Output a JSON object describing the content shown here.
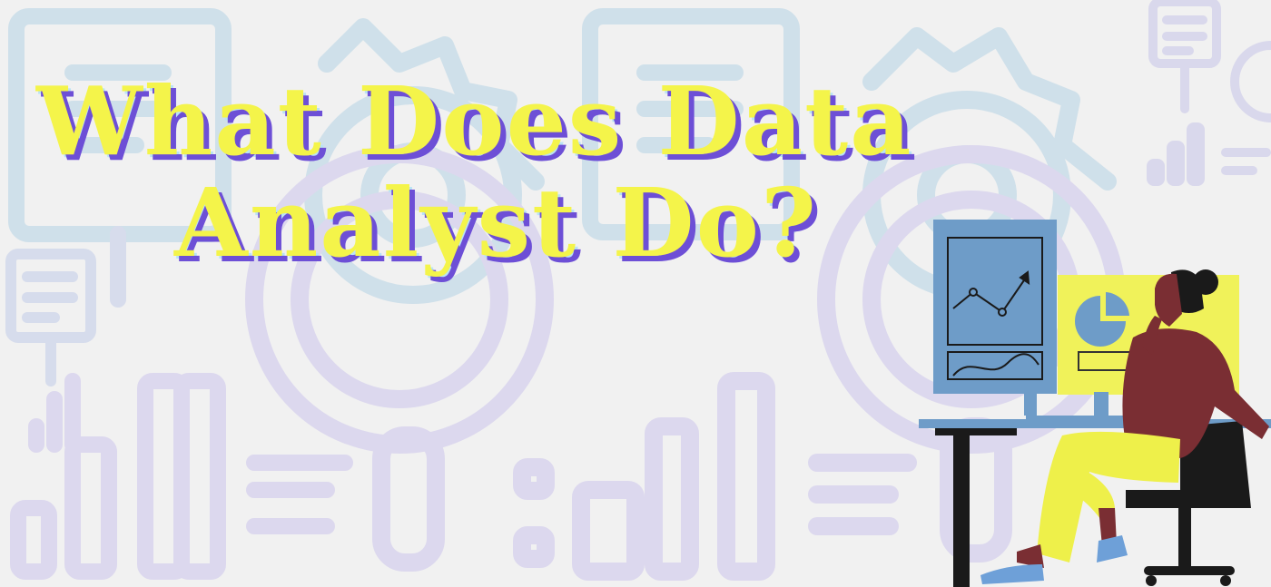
{
  "banner": {
    "title_line_1": "What Does Data",
    "title_line_2": "Analyst Do?"
  },
  "colors": {
    "background": "#f1f1f1",
    "pattern_blue": "#cfe0ea",
    "pattern_lavender": "#dcd8ee",
    "title_fill": "#f4f44a",
    "title_shadow": "#6d4fd6",
    "monitor_blue": "#6e9cc8",
    "monitor_yellow": "#f0f25a",
    "skin": "#7a2e33",
    "pants": "#eef04a",
    "chair": "#1a1a1a",
    "shoes": "#6ea0d8"
  },
  "icons": [
    "chart-board-icon",
    "gear-icon",
    "magnifier-icon",
    "bar-chart-icon",
    "line-chart-icon",
    "pie-chart-icon"
  ]
}
